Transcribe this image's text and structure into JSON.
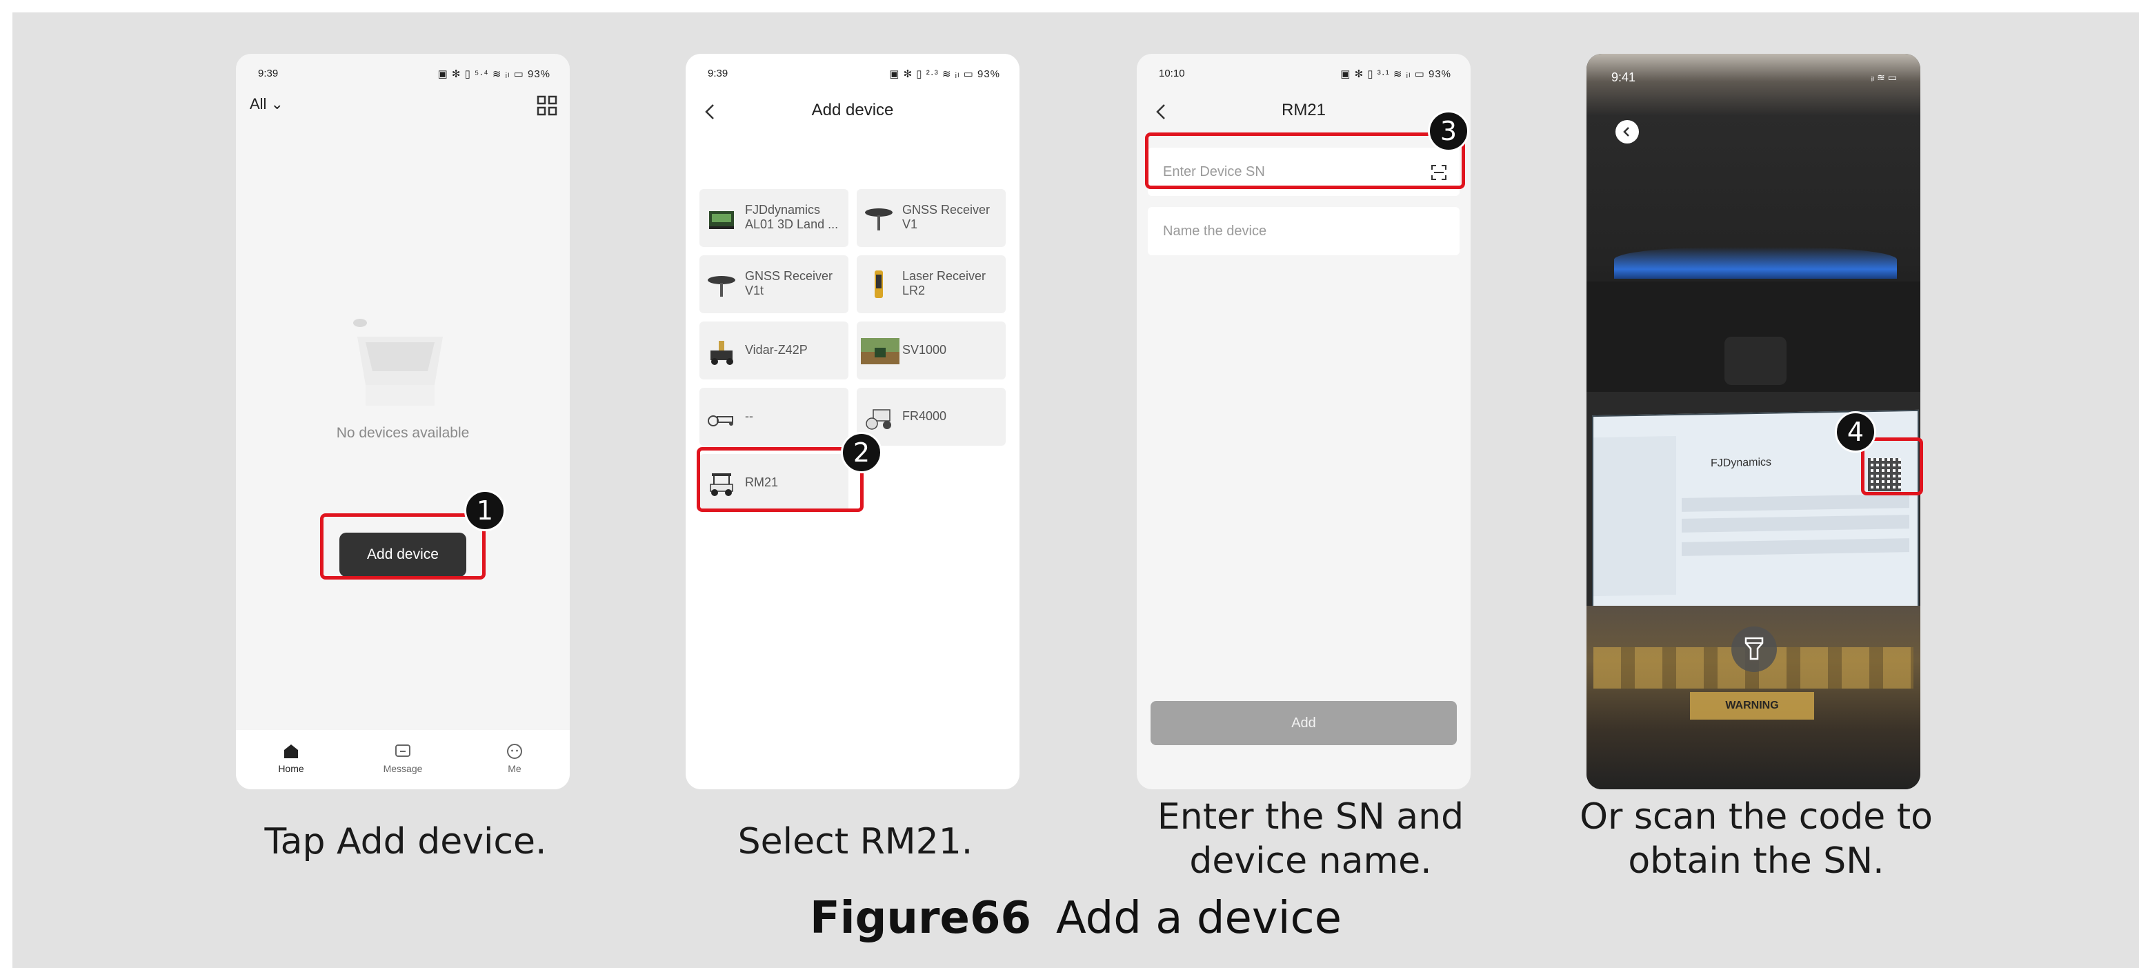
{
  "phones": {
    "home": {
      "status_time": "9:39",
      "status_icons": "▣ ✻ ▯ ⁵·⁴ ≋ ᵢₗ ▭ 93%",
      "filter_label": "All ⌄",
      "empty_text": "No devices available",
      "add_button": "Add device",
      "tabs": [
        {
          "label": "Home",
          "icon": "home-icon"
        },
        {
          "label": "Message",
          "icon": "message-icon"
        },
        {
          "label": "Me",
          "icon": "me-icon"
        }
      ]
    },
    "add_device": {
      "status_time": "9:39",
      "status_icons": "▣ ✻ ▯ ²·³ ≋ ᵢₗ ▭ 93%",
      "title": "Add device",
      "devices": [
        {
          "name": "FJDdynamics AL01 3D Land ..."
        },
        {
          "name": "GNSS Receiver V1"
        },
        {
          "name": "GNSS Receiver V1t"
        },
        {
          "name": "Laser Receiver LR2"
        },
        {
          "name": "Vidar-Z42P"
        },
        {
          "name": "SV1000"
        },
        {
          "name": "--"
        },
        {
          "name": "FR4000"
        },
        {
          "name": "RM21"
        }
      ]
    },
    "enter_sn": {
      "status_time": "10:10",
      "status_icons": "▣ ✻ ▯ ³·¹ ≋ ᵢₗ ▭ 93%",
      "title": "RM21",
      "sn_placeholder": "Enter Device SN",
      "name_placeholder": "Name the device",
      "add_button": "Add"
    },
    "scan": {
      "status_time": "9:41",
      "status_icons": "ᵢₗ ≋ ▭",
      "brand_text": "FJDynamics",
      "warning_text": "WARNING"
    }
  },
  "badges": [
    "1",
    "2",
    "3",
    "4"
  ],
  "captions": [
    "Tap Add device.",
    "Select RM21.",
    "Enter the SN and device name.",
    "Or scan the   code to obtain the SN."
  ],
  "figure": {
    "number": "Figure66",
    "title": "Add a   device"
  }
}
